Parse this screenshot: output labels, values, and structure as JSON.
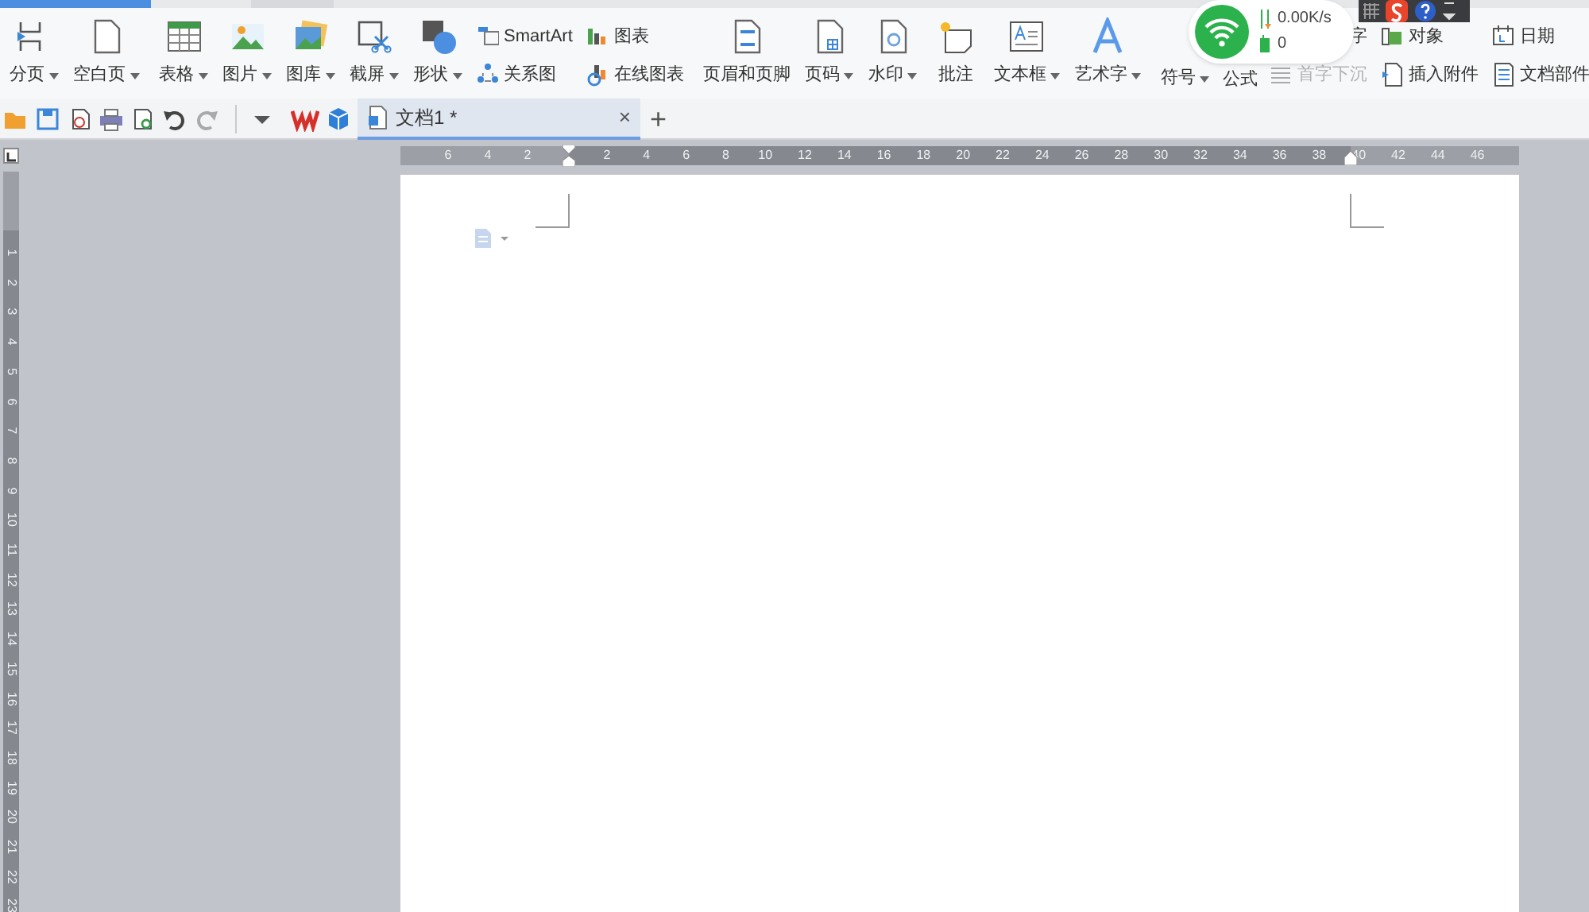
{
  "ribbon": {
    "groups": [
      {
        "items": [
          {
            "kind": "large",
            "label": "分页",
            "dropdown": true
          },
          {
            "kind": "large",
            "label": "空白页",
            "dropdown": true
          }
        ]
      },
      {
        "items": [
          {
            "kind": "large",
            "label": "表格",
            "dropdown": true
          },
          {
            "kind": "large",
            "label": "图片",
            "dropdown": true
          },
          {
            "kind": "large",
            "label": "图库",
            "dropdown": true
          },
          {
            "kind": "large",
            "label": "截屏",
            "dropdown": true
          },
          {
            "kind": "large",
            "label": "形状",
            "dropdown": true
          },
          {
            "kind": "stack",
            "items": [
              {
                "label": "SmartArt",
                "disabled": false
              },
              {
                "label": "关系图",
                "disabled": false
              }
            ]
          },
          {
            "kind": "stack",
            "items": [
              {
                "label": "图表",
                "disabled": false
              },
              {
                "label": "在线图表",
                "disabled": false
              }
            ]
          }
        ]
      },
      {
        "items": [
          {
            "kind": "large",
            "label": "页眉和页脚",
            "dropdown": false
          },
          {
            "kind": "large",
            "label": "页码",
            "dropdown": true
          },
          {
            "kind": "large",
            "label": "水印",
            "dropdown": true
          }
        ]
      },
      {
        "items": [
          {
            "kind": "large",
            "label": "批注",
            "dropdown": false
          }
        ]
      },
      {
        "items": [
          {
            "kind": "large",
            "label": "文本框",
            "dropdown": true
          },
          {
            "kind": "large",
            "label": "艺术字",
            "dropdown": true
          }
        ]
      },
      {
        "items": [
          {
            "kind": "large",
            "label": "符号",
            "dropdown": true
          },
          {
            "kind": "stack",
            "items": [
              {
                "label": "公式",
                "disabled": false
              }
            ]
          },
          {
            "kind": "stack",
            "items": [
              {
                "label": "字",
                "disabled": false
              },
              {
                "label": "首字下沉",
                "disabled": true
              }
            ]
          },
          {
            "kind": "stack",
            "items": [
              {
                "label": "对象",
                "disabled": false
              },
              {
                "label": "插入附件",
                "disabled": false
              }
            ]
          },
          {
            "kind": "stack",
            "items": [
              {
                "label": "日期",
                "disabled": false
              },
              {
                "label": "文档部件",
                "disabled": false
              }
            ]
          }
        ]
      }
    ]
  },
  "network_widget": {
    "speed": "0.00K/s",
    "count": "0"
  },
  "tabs": [
    {
      "label": "文档1 *",
      "selected": true,
      "close": "×"
    }
  ],
  "new_tab": "+",
  "horizontal_ruler": {
    "labels": [
      "6",
      "4",
      "2",
      "2",
      "4",
      "6",
      "8",
      "10",
      "12",
      "14",
      "16",
      "18",
      "20",
      "22",
      "24",
      "26",
      "28",
      "30",
      "32",
      "34",
      "36",
      "38",
      "40",
      "42",
      "44",
      "46"
    ]
  },
  "vertical_ruler": {
    "labels": [
      "1",
      "2",
      "3",
      "4",
      "5",
      "6",
      "7",
      "8",
      "9",
      "10",
      "11",
      "12",
      "13",
      "14",
      "15",
      "16",
      "17",
      "18",
      "19",
      "20",
      "21",
      "22",
      "23"
    ]
  }
}
